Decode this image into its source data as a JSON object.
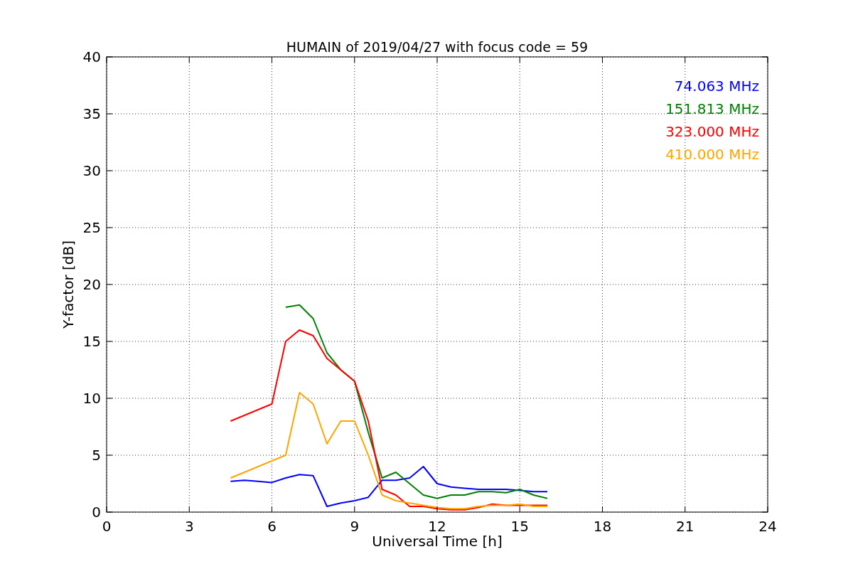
{
  "chart_data": {
    "type": "line",
    "title": "HUMAIN of 2019/04/27 with focus code = 59",
    "xlabel": "Universal Time [h]",
    "ylabel": "Y-factor [dB]",
    "x": [
      4.5,
      5,
      5.5,
      6,
      6.5,
      7,
      7.5,
      8,
      8.5,
      9,
      9.5,
      10,
      10.5,
      11,
      11.5,
      12,
      12.5,
      13,
      13.5,
      14,
      14.5,
      15,
      15.5,
      16
    ],
    "series": [
      {
        "name": "74.063 MHz",
        "color": "#0000ff",
        "values": [
          2.7,
          2.8,
          2.7,
          2.6,
          3.0,
          3.3,
          3.2,
          0.5,
          0.8,
          1.0,
          1.3,
          2.8,
          2.8,
          3.0,
          4.0,
          2.5,
          2.2,
          2.1,
          2.0,
          2.0,
          2.0,
          1.9,
          1.8,
          1.8
        ]
      },
      {
        "name": "151.813 MHz",
        "color": "#008000",
        "values": [
          null,
          null,
          null,
          null,
          18,
          18.2,
          17,
          14,
          12.5,
          11.5,
          7,
          3,
          3.5,
          2.5,
          1.5,
          1.2,
          1.5,
          1.5,
          1.8,
          1.8,
          1.7,
          2.0,
          1.5,
          1.2
        ]
      },
      {
        "name": "323.000 MHz",
        "color": "#ff0000",
        "values": [
          8,
          8.5,
          9,
          9.5,
          15,
          16,
          15.5,
          13.5,
          12.5,
          11.5,
          8,
          2,
          1.5,
          0.5,
          0.5,
          0.3,
          0.2,
          0.2,
          0.4,
          0.7,
          0.6,
          0.6,
          0.6,
          0.6
        ]
      },
      {
        "name": "410.000 MHz",
        "color": "#ffa500",
        "values": [
          3,
          3.5,
          4,
          4.5,
          5,
          10.5,
          9.5,
          6,
          8,
          8,
          5,
          1.5,
          1.0,
          0.8,
          0.6,
          0.4,
          0.3,
          0.3,
          0.5,
          0.6,
          0.6,
          0.7,
          0.5,
          0.5
        ]
      }
    ],
    "grid": true,
    "xlim": [
      0,
      24
    ],
    "ylim": [
      0,
      40
    ],
    "xticks": [
      0,
      3,
      6,
      9,
      12,
      15,
      18,
      21,
      24
    ],
    "yticks": [
      0,
      5,
      10,
      15,
      20,
      25,
      30,
      35,
      40
    ]
  }
}
